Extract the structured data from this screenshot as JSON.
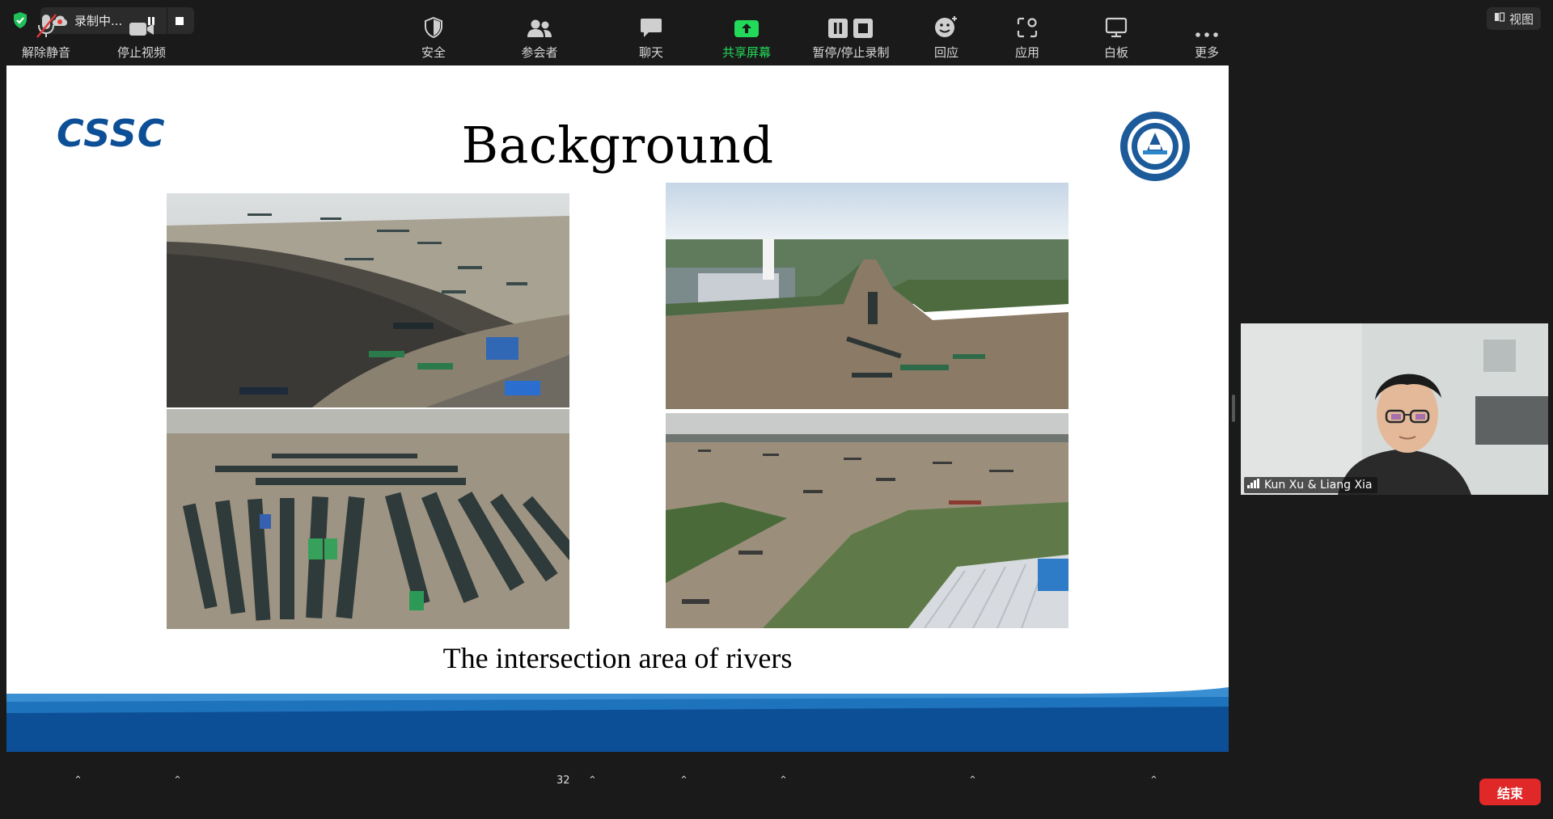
{
  "recording": {
    "status": "录制中..."
  },
  "view_button": {
    "label": "视图"
  },
  "slide": {
    "logo_text": "CSSC",
    "title": "Background",
    "caption": "The intersection area of rivers"
  },
  "participant": {
    "name": "Kun Xu  & Liang Xia"
  },
  "toolbar": {
    "unmute": "解除静音",
    "stop_video": "停止视频",
    "security": "安全",
    "participants": "参会者",
    "participants_count": "32",
    "chat": "聊天",
    "share_screen": "共享屏幕",
    "pause_recording": "暂停/停止录制",
    "reactions": "回应",
    "apps": "应用",
    "whiteboard": "白板",
    "more": "更多",
    "end": "结束"
  },
  "colors": {
    "share_green": "#23d959",
    "end_red": "#e02828",
    "slide_blue": "#0d4f96",
    "mute_red": "#e03535"
  }
}
